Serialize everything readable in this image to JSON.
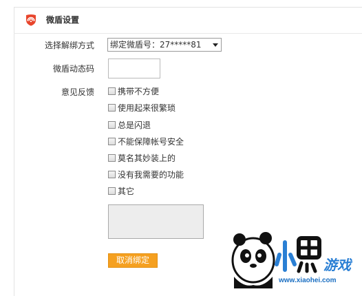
{
  "header": {
    "title": "微盾设置",
    "logo_icon": "weidun-shield-icon"
  },
  "form": {
    "unbind_method_label": "选择解绑方式",
    "unbind_method_value": "绑定微盾号：27*****81",
    "dynamic_code_label": "微盾动态码",
    "dynamic_code_value": "",
    "feedback_label": "意见反馈",
    "feedback_options": [
      "携带不方便",
      "使用起来很繁琐",
      "总是闪退",
      "不能保障帐号安全",
      "莫名其妙装上的",
      "没有我需要的功能",
      "其它"
    ],
    "feedback_text": "",
    "cancel_bind_button": "取消绑定"
  },
  "watermark": {
    "url": "www.xiaohei.com",
    "brand_colors": [
      "#2a7fd4",
      "#111111"
    ]
  },
  "colors": {
    "accent": "#f5a020",
    "logo": "#e8452c"
  }
}
